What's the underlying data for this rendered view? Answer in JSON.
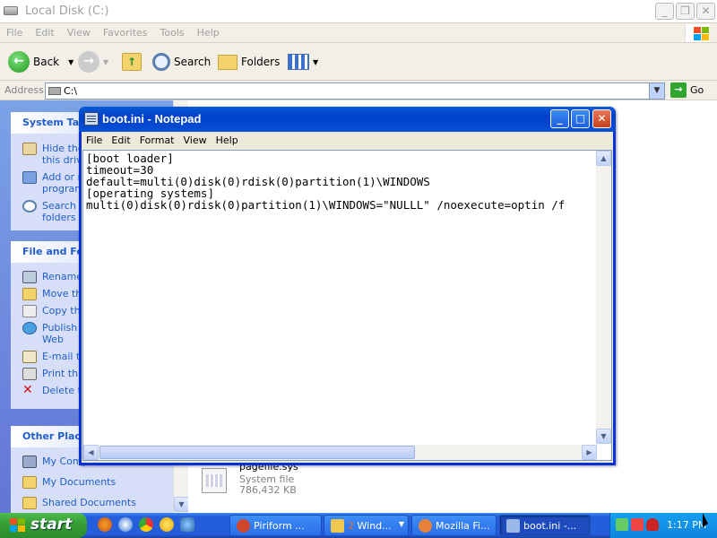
{
  "explorer": {
    "title": "Local Disk (C:)",
    "menu": [
      "File",
      "Edit",
      "View",
      "Favorites",
      "Tools",
      "Help"
    ],
    "toolbar": {
      "back": "Back",
      "search": "Search",
      "folders": "Folders"
    },
    "address": {
      "label": "Address",
      "value": "C:\\",
      "go": "Go"
    },
    "panels": {
      "system_tasks": {
        "title": "System Tas",
        "items": [
          [
            "Hide the",
            "this drive"
          ],
          [
            "Add or r",
            "program"
          ],
          [
            "Search f",
            "folders"
          ]
        ]
      },
      "file_folder": {
        "title": "File and Fol",
        "items": [
          [
            "Rename"
          ],
          [
            "Move th"
          ],
          [
            "Copy thi"
          ],
          [
            "Publish t",
            "Web"
          ],
          [
            "E-mail th"
          ],
          [
            "Print this"
          ],
          [
            "Delete th"
          ]
        ]
      },
      "other_places": {
        "title": "Other Place",
        "items": [
          "My Comp",
          "My Documents",
          "Shared Documents"
        ]
      }
    },
    "file": {
      "name": "pagefile.sys",
      "type": "System file",
      "size": "786,432 KB"
    }
  },
  "notepad": {
    "title": "boot.ini - Notepad",
    "menu": [
      "File",
      "Edit",
      "Format",
      "View",
      "Help"
    ],
    "content": "[boot loader]\ntimeout=30\ndefault=multi(0)disk(0)rdisk(0)partition(1)\\WINDOWS\n[operating systems]\nmulti(0)disk(0)rdisk(0)partition(1)\\WINDOWS=\"NULLL\" /noexecute=optin /f"
  },
  "taskbar": {
    "start": "start",
    "tasks": [
      {
        "label": "Piriform ...",
        "icon_color": "#d0462a"
      },
      {
        "label": "2 Wind...",
        "prefix_color": "#e86a2a",
        "icon_color": "#f0c850"
      },
      {
        "label": "Mozilla Fi...",
        "icon_color": "#e8823a"
      },
      {
        "label": "boot.ini -...",
        "icon_color": "#9ab8e8"
      }
    ],
    "clock": "1:17 PM"
  }
}
